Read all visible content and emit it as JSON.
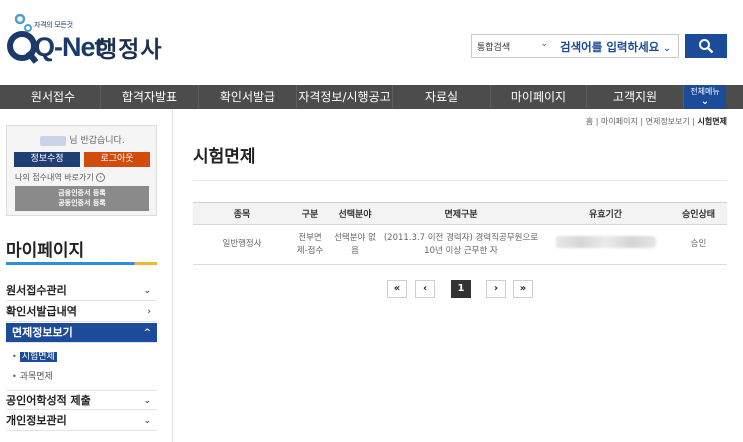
{
  "header": {
    "logo_small": "자격의 모든것",
    "logo_text": "Q-Net",
    "site_title": "행정사",
    "search": {
      "category": "통합검색",
      "placeholder": "검색어를 입력하세요"
    }
  },
  "gnb": {
    "items": [
      "원서접수",
      "합격자발표",
      "확인서발급",
      "자격정보/시행공고",
      "자료실",
      "마이페이지",
      "고객지원"
    ],
    "all_menu_label": "전체메뉴"
  },
  "sidebar": {
    "greeting_suffix": "님 반갑습니다.",
    "edit_info": "정보수정",
    "logout": "로그아웃",
    "shortcut": "나의 접수내역 바로가기",
    "cert_line1": "금융인증서 등록",
    "cert_line2": "공동인증서 등록",
    "mypage_title": "마이페이지",
    "menus": [
      {
        "label": "원서접수관리",
        "chev": "⌄"
      },
      {
        "label": "확인서발급내역",
        "chev": "›"
      },
      {
        "label": "면제정보보기",
        "chev": "^"
      },
      {
        "label": "공인어학성적 제출",
        "chev": "⌄"
      },
      {
        "label": "개인정보관리",
        "chev": "⌄"
      }
    ],
    "submenus": [
      "시험면제",
      "과목면제"
    ]
  },
  "breadcrumb": {
    "home": "홈",
    "level1": "마이페이지",
    "level2": "면제정보보기",
    "current": "시험면제"
  },
  "main": {
    "title": "시험면제",
    "table": {
      "headers": [
        "종목",
        "구분",
        "선택분야",
        "면제구분",
        "유효기간",
        "승인상태"
      ],
      "rows": [
        {
          "type": "일반행정사",
          "category": "전부면제-접수",
          "field": "선택분야 없음",
          "exemption": "(2011.3.7 이전 경력자) 경력직공무원으로 10년 이상 근무한 자",
          "status": "승인"
        }
      ]
    },
    "pagination": {
      "first": "«",
      "prev": "‹",
      "current_page": "1",
      "next": "›",
      "last": "»"
    }
  },
  "colors": {
    "brand_navy": "#1c4b9a",
    "gnb_bg": "#4c4c4c",
    "logout_orange": "#d24c0d"
  }
}
